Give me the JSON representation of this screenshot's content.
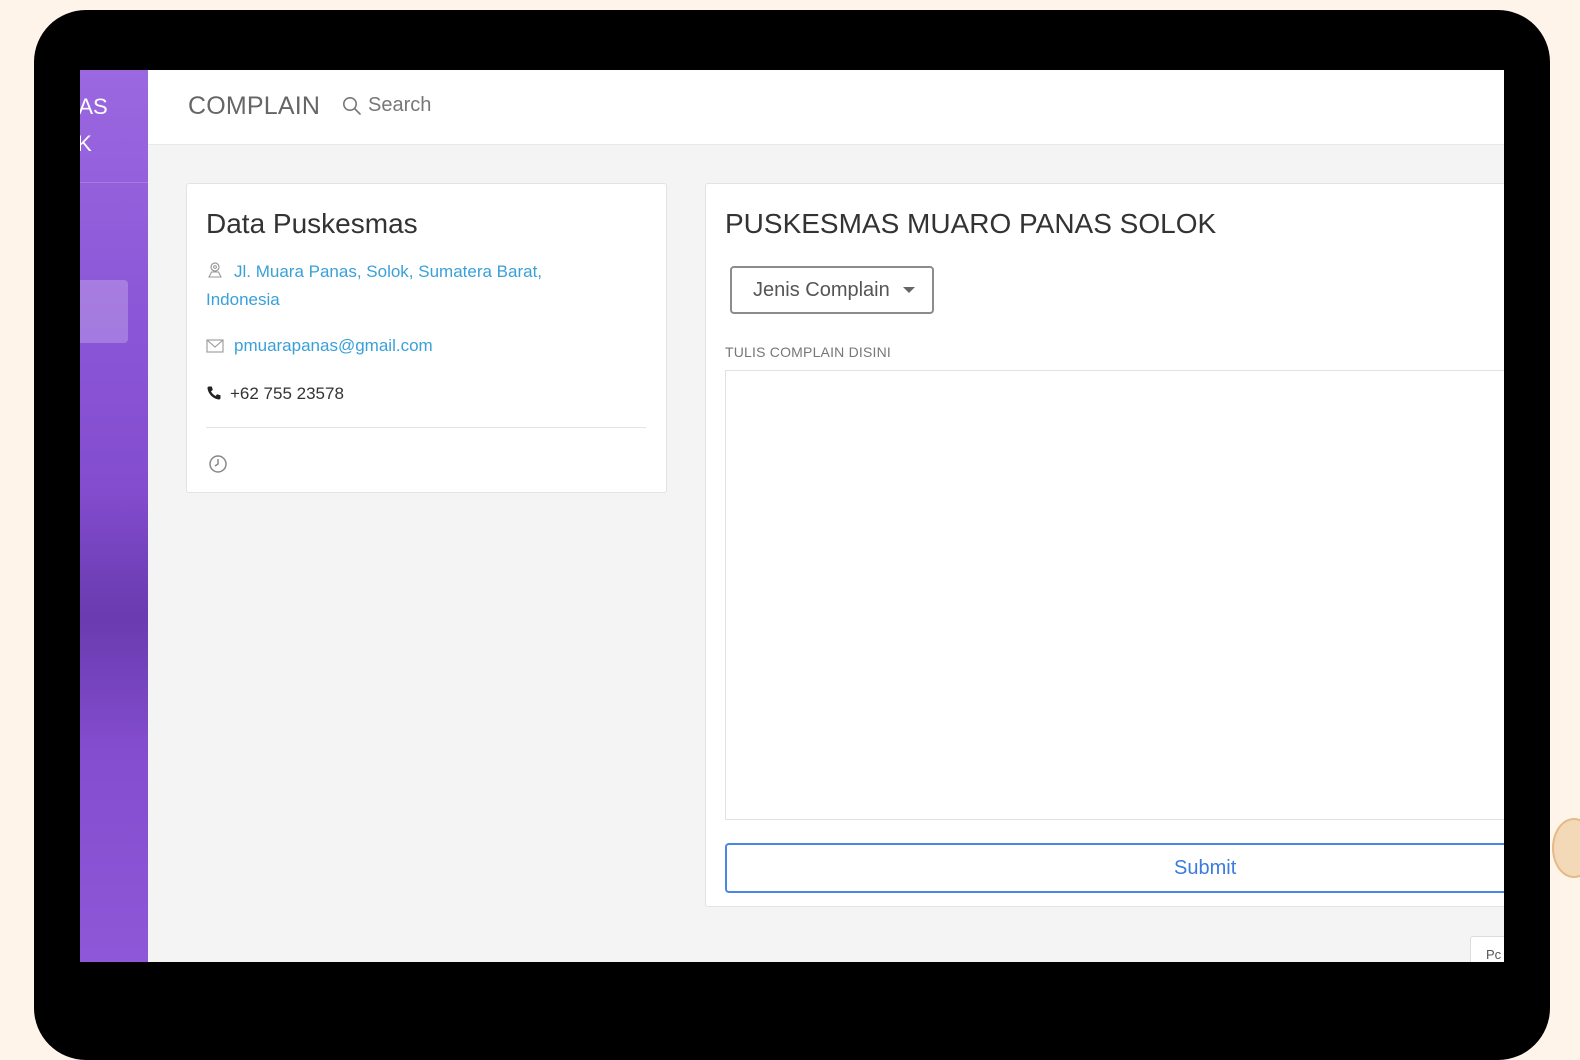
{
  "sidebar": {
    "brand_line1": "MAS",
    "brand_line2": "OK"
  },
  "topbar": {
    "title": "COMPLAIN",
    "search_placeholder": "Search"
  },
  "info_card": {
    "title": "Data Puskesmas",
    "address": "Jl. Muara Panas, Solok, Sumatera Barat, Indonesia",
    "email": "pmuarapanas@gmail.com",
    "phone": "+62 755 23578",
    "icons": [
      "location-icon",
      "mail-icon",
      "phone-icon",
      "clock-icon"
    ]
  },
  "complain_card": {
    "title": "PUSKESMAS MUARO PANAS SOLOK",
    "dropdown_label": "Jenis Complain",
    "field_label": "TULIS COMPLAIN DISINI",
    "textarea_value": "",
    "submit_label": "Submit"
  },
  "footer": {
    "corner_button_label": "Pc"
  },
  "colors": {
    "sidebar": "#8a55d6",
    "link": "#3aa0d8",
    "submit_border": "#4a86e8",
    "page_bg": "#fff4ea"
  }
}
